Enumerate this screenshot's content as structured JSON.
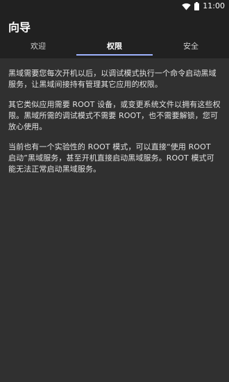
{
  "status_bar": {
    "time": "11:00",
    "icons": [
      "wifi-icon",
      "battery-icon"
    ]
  },
  "app_bar": {
    "title": "向导"
  },
  "tabs": [
    {
      "label": "欢迎",
      "active": false
    },
    {
      "label": "权限",
      "active": true
    },
    {
      "label": "安全",
      "active": false
    }
  ],
  "content": {
    "paragraphs": [
      "黑域需要您每次开机以后，以调试模式执行一个命令启动黑域服务，让黑域间接持有管理其它应用的权限。",
      "其它类似应用需要 ROOT 设备，或变更系统文件以拥有这些权限。黑域所需的调试模式不需要 ROOT，也不需要解锁，您可放心使用。",
      "当前也有一个实验性的 ROOT 模式，可以直接“使用 ROOT 启动”黑域服务，甚至开机直接启动黑域服务。ROOT 模式可能无法正常启动黑域服务。"
    ]
  },
  "colors": {
    "background": "#303030",
    "app_bar": "#212121",
    "tab_indicator": "#9fb3ff"
  }
}
